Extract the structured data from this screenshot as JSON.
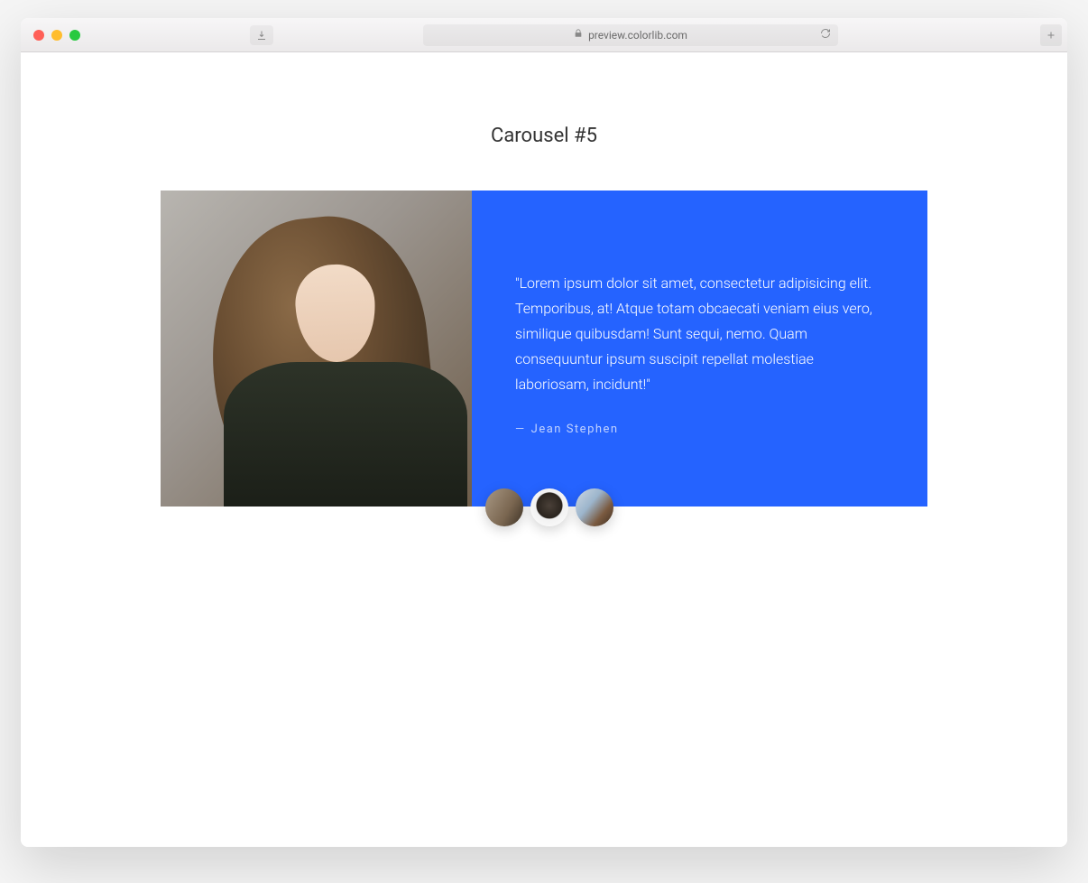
{
  "browser": {
    "url": "preview.colorlib.com"
  },
  "page": {
    "title": "Carousel #5"
  },
  "carousel": {
    "quote": "\"Lorem ipsum dolor sit amet, consectetur adipisicing elit. Temporibus, at! Atque totam obcaecati veniam eius vero, similique quibusdam! Sunt sequi, nemo. Quam consequuntur ipsum suscipit repellat molestiae laboriosam, incidunt!\"",
    "author_prefix": "—",
    "author": "Jean Stephen",
    "thumbs": [
      {
        "alt": "person-1",
        "active": true
      },
      {
        "alt": "person-2",
        "active": false
      },
      {
        "alt": "person-3",
        "active": false
      }
    ]
  },
  "colors": {
    "accent": "#2563ff"
  }
}
